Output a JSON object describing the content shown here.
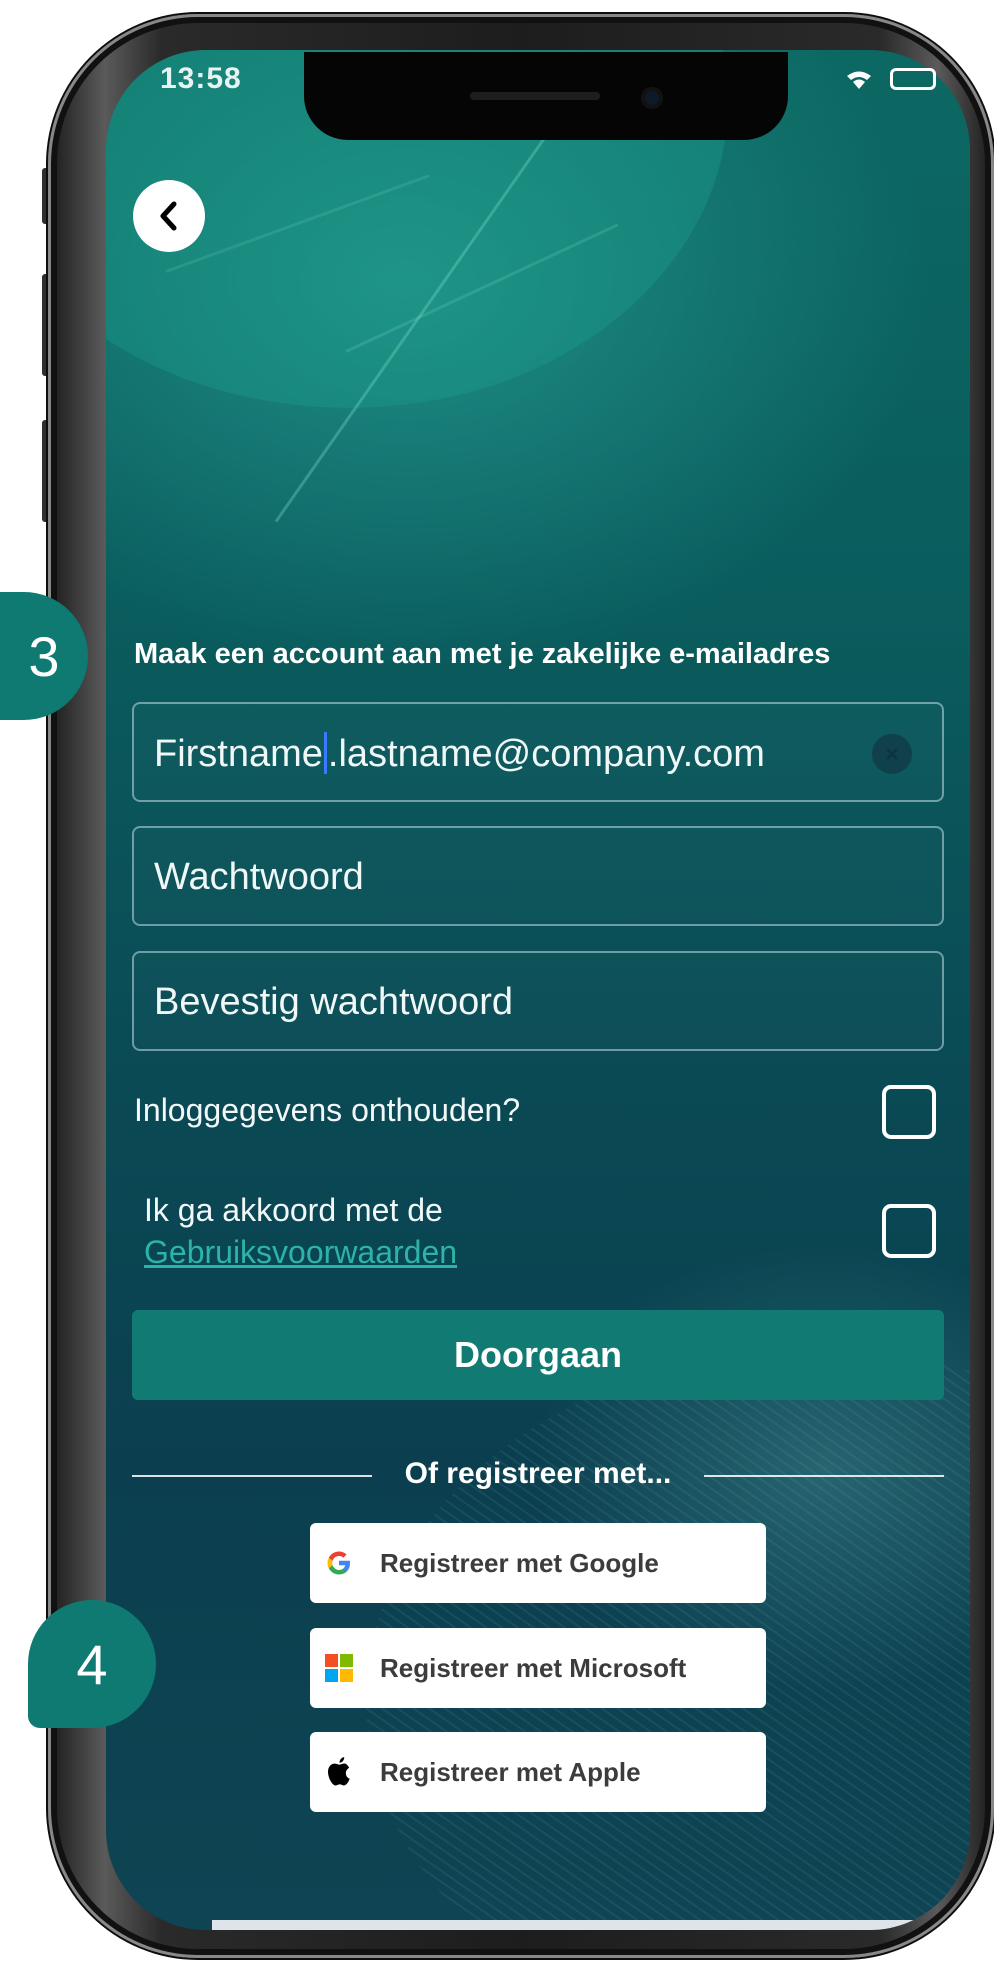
{
  "status_bar": {
    "time": "13:58"
  },
  "steps": {
    "step_3": "3",
    "step_4": "4"
  },
  "form": {
    "title": "Maak een account aan met je zakelijke e-mailadres",
    "email_value_before_cursor": "Firstname",
    "email_value_after_cursor": ".lastname@company.com",
    "password_placeholder": "Wachtwoord",
    "confirm_password_placeholder": "Bevestig wachtwoord",
    "remember_label": "Inloggegevens onthouden?",
    "remember_checked": false,
    "terms_label": "Ik ga akkoord met de",
    "terms_link": "Gebruiksvoorwaarden",
    "terms_checked": false,
    "continue_label": "Doorgaan"
  },
  "social": {
    "divider_label": "Of registreer met...",
    "google_label": "Registreer met Google",
    "microsoft_label": "Registreer met Microsoft",
    "apple_label": "Registreer met Apple"
  },
  "icons": [
    "back-chevron-icon",
    "wifi-icon",
    "battery-icon",
    "clear-icon",
    "google-icon",
    "microsoft-icon",
    "apple-icon"
  ],
  "colors": {
    "accent": "#117b73",
    "link": "#2db3a8",
    "background_top": "#0c6862",
    "background_bottom": "#0b3f4f",
    "badge": "#0f7a72"
  }
}
